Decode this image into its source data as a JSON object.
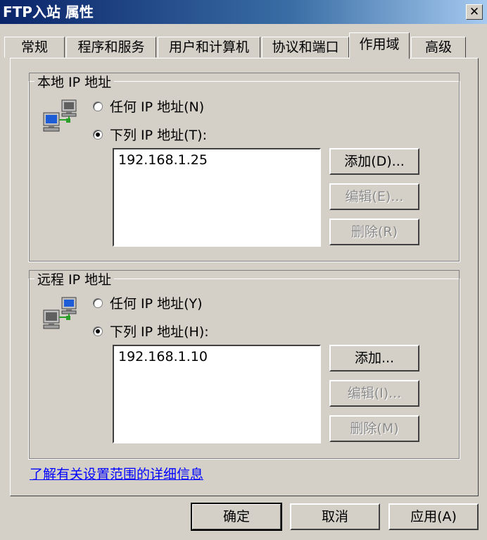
{
  "window": {
    "title": "FTP入站 属性",
    "close_glyph": "✕"
  },
  "tabs": [
    {
      "label": "常规"
    },
    {
      "label": "程序和服务"
    },
    {
      "label": "用户和计算机"
    },
    {
      "label": "协议和端口"
    },
    {
      "label": "作用域",
      "active": true
    },
    {
      "label": "高级"
    }
  ],
  "local": {
    "legend": "本地 IP 地址",
    "any_label": "任何 IP 地址(N)",
    "list_label": "下列 IP 地址(T):",
    "selected": "list",
    "addresses": [
      "192.168.1.25"
    ],
    "add_label": "添加(D)...",
    "edit_label": "编辑(E)...",
    "delete_label": "删除(R)"
  },
  "remote": {
    "legend": "远程 IP 地址",
    "any_label": "任何 IP 地址(Y)",
    "list_label": "下列 IP 地址(H):",
    "selected": "list",
    "addresses": [
      "192.168.1.10"
    ],
    "add_label": "添加...",
    "edit_label": "编辑(I)...",
    "delete_label": "删除(M)"
  },
  "help_link": "了解有关设置范围的详细信息",
  "buttons": {
    "ok": "确定",
    "cancel": "取消",
    "apply": "应用(A)"
  },
  "colors": {
    "face": "#d4d0c8",
    "title_start": "#0a246a",
    "link": "#0000ff"
  }
}
